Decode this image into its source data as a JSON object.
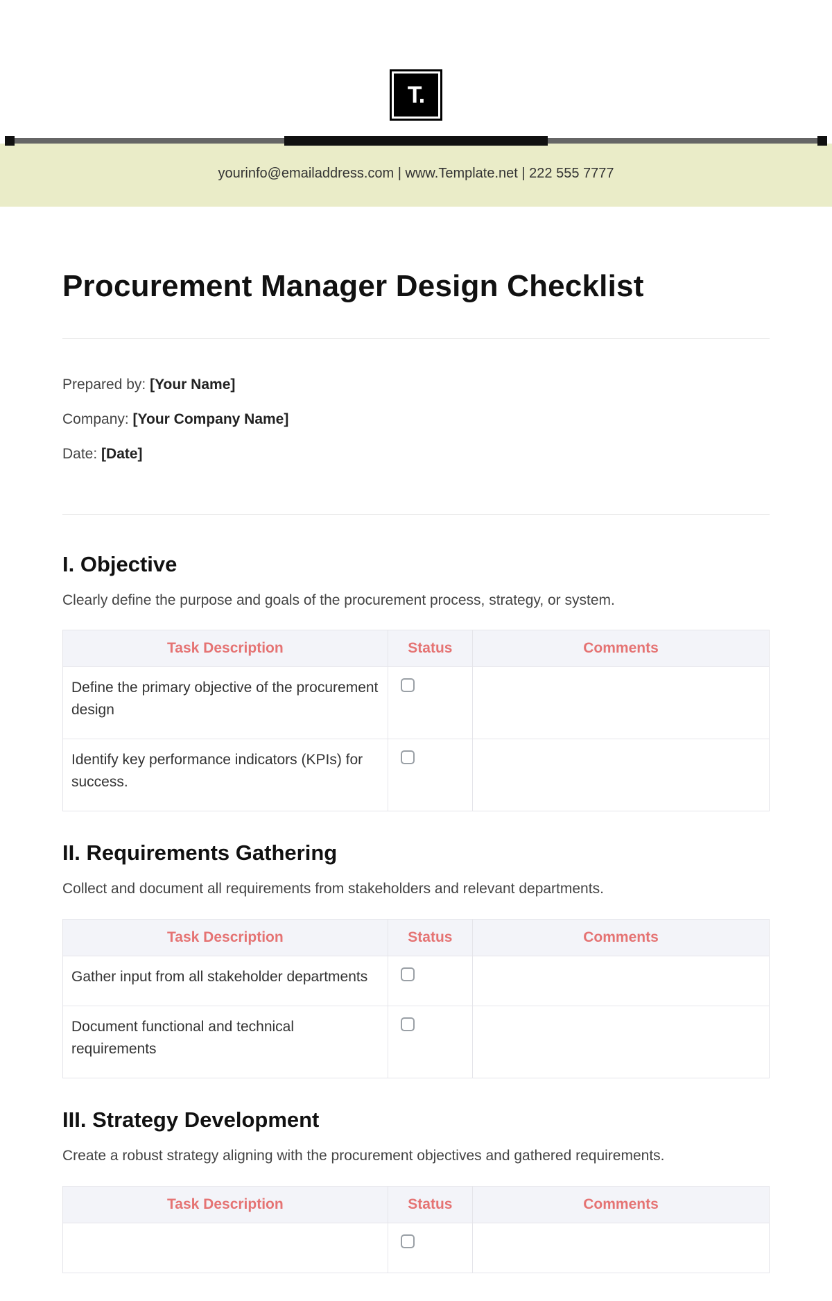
{
  "logo_text": "T.",
  "info_band": {
    "email": "yourinfo@emailaddress.com",
    "website": "www.Template.net",
    "phone": "222 555 7777",
    "sep": "  |  "
  },
  "title": "Procurement Manager Design Checklist",
  "meta": {
    "prepared_label": "Prepared by: ",
    "prepared_value": "[Your Name]",
    "company_label": "Company: ",
    "company_value": "[Your Company Name]",
    "date_label": "Date: ",
    "date_value": "[Date]"
  },
  "table_headers": {
    "desc": "Task Description",
    "status": "Status",
    "comments": "Comments"
  },
  "sections": [
    {
      "num": "I.",
      "heading": "I. Objective",
      "desc": "Clearly define the purpose and goals of the procurement process, strategy, or system.",
      "rows": [
        {
          "task": "Define the primary objective of the procurement design",
          "comment": ""
        },
        {
          "task": "Identify key performance indicators (KPIs) for success.",
          "comment": ""
        }
      ]
    },
    {
      "num": "II.",
      "heading": "II. Requirements Gathering",
      "desc": "Collect and document all requirements from stakeholders and relevant departments.",
      "rows": [
        {
          "task": "Gather input from all stakeholder departments",
          "comment": ""
        },
        {
          "task": "Document functional and technical requirements",
          "comment": ""
        }
      ]
    },
    {
      "num": "III.",
      "heading": "III. Strategy Development",
      "desc": "Create a robust strategy aligning with the procurement objectives and gathered requirements.",
      "rows": [
        {
          "task": "",
          "comment": ""
        }
      ]
    }
  ]
}
